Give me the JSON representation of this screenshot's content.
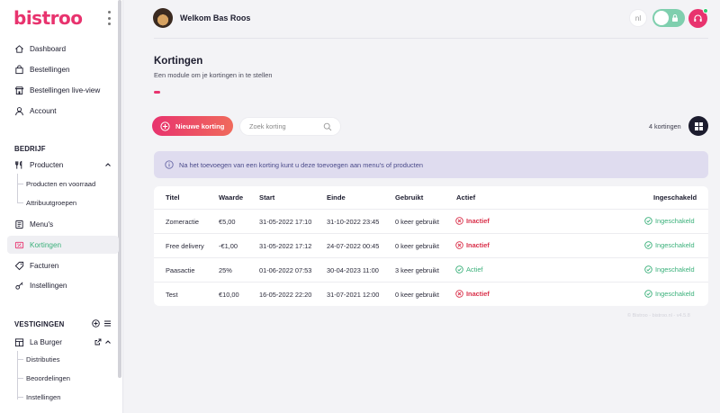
{
  "brand": {
    "name": "bistroo",
    "color": "#e8336e"
  },
  "sidebar": {
    "items": [
      {
        "label": "Dashboard",
        "icon": "home-icon"
      },
      {
        "label": "Bestellingen",
        "icon": "shopping-bag-icon"
      },
      {
        "label": "Bestellingen live-view",
        "icon": "storefront-icon"
      },
      {
        "label": "Account",
        "icon": "user-icon"
      }
    ],
    "section_company": "BEDRIJF",
    "producten": {
      "label": "Producten",
      "icon": "utensils-icon",
      "sub": [
        "Producten en voorraad",
        "Attribuutgroepen"
      ]
    },
    "company_items": [
      {
        "label": "Menu's",
        "icon": "menu-book-icon"
      },
      {
        "label": "Kortingen",
        "icon": "discount-icon"
      },
      {
        "label": "Facturen",
        "icon": "tag-icon"
      },
      {
        "label": "Instellingen",
        "icon": "settings-icon"
      }
    ],
    "section_locations": "VESTIGINGEN",
    "location": {
      "label": "La Burger",
      "icon": "store-icon",
      "sub": [
        "Distributies",
        "Beoordelingen",
        "Instellingen"
      ]
    }
  },
  "header": {
    "welcome": "Welkom Bas Roos",
    "lang": "nl"
  },
  "page": {
    "title": "Kortingen",
    "subtitle": "Een module om je kortingen in te stellen"
  },
  "toolbar": {
    "new_label": "Nieuwe korting",
    "search_placeholder": "Zoek korting",
    "count": "4 kortingen"
  },
  "info": "Na het toevoegen van een korting kunt u deze toevoegen aan menu's of producten",
  "table": {
    "headers": [
      "Titel",
      "Waarde",
      "Start",
      "Einde",
      "Gebruikt",
      "Actief",
      "Ingeschakeld"
    ],
    "rows": [
      {
        "titel": "Zomeractie",
        "waarde": "€5,00",
        "start": "31-05-2022 17:10",
        "einde": "31-10-2022 23:45",
        "gebruikt": "0 keer gebruikt",
        "actief": "Inactief",
        "ingeschakeld": "Ingeschakeld"
      },
      {
        "titel": "Free delivery",
        "waarde": "-€1,00",
        "start": "31-05-2022 17:12",
        "einde": "24-07-2022 00:45",
        "gebruikt": "0 keer gebruikt",
        "actief": "Inactief",
        "ingeschakeld": "Ingeschakeld"
      },
      {
        "titel": "Paasactie",
        "waarde": "25%",
        "start": "01-06-2022 07:53",
        "einde": "30-04-2023 11:00",
        "gebruikt": "3 keer gebruikt",
        "actief": "Actief",
        "ingeschakeld": "Ingeschakeld"
      },
      {
        "titel": "Test",
        "waarde": "€10,00",
        "start": "16-05-2022 22:20",
        "einde": "31-07-2021 12:00",
        "gebruikt": "0 keer gebruikt",
        "actief": "Inactief",
        "ingeschakeld": "Ingeschakeld"
      }
    ]
  },
  "footer": "© Bistroo - bistroo.nl - v4.5.8",
  "colors": {
    "inactive": "#d9304a",
    "active": "#3ab07a",
    "toggle": "#7fcfae"
  }
}
